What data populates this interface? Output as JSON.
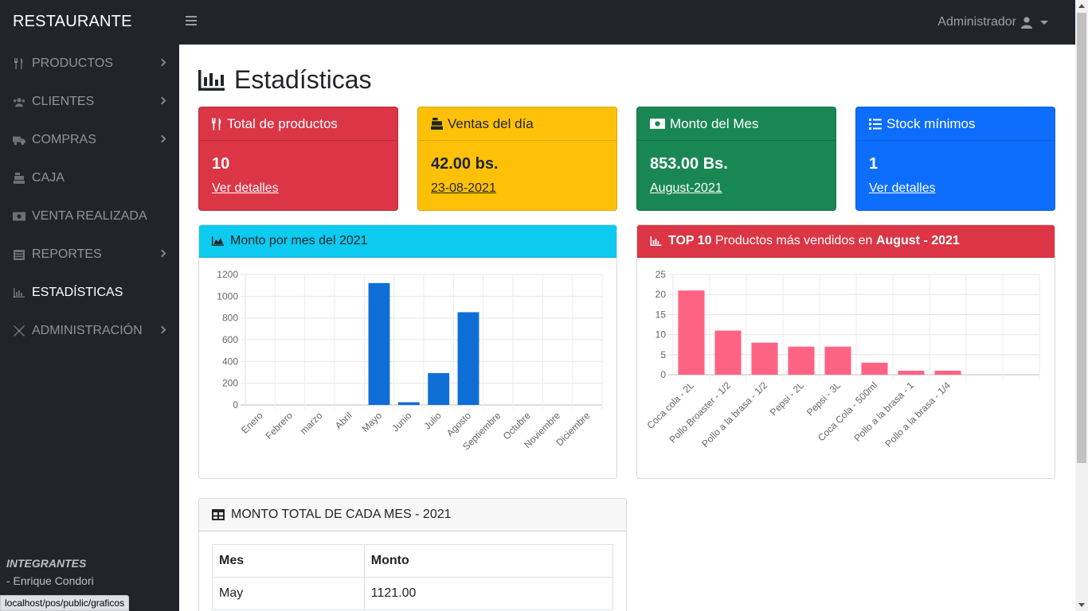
{
  "app": {
    "brand": "RESTAURANTE",
    "user": "Administrador"
  },
  "sidebar": {
    "items": [
      {
        "label": "PRODUCTOS",
        "icon": "utensils-icon",
        "has_submenu": true
      },
      {
        "label": "CLIENTES",
        "icon": "users-icon",
        "has_submenu": true
      },
      {
        "label": "COMPRAS",
        "icon": "truck-icon",
        "has_submenu": true
      },
      {
        "label": "CAJA",
        "icon": "cash-register-icon",
        "has_submenu": false
      },
      {
        "label": "VENTA REALIZADA",
        "icon": "money-bill-icon",
        "has_submenu": false
      },
      {
        "label": "REPORTES",
        "icon": "list-icon",
        "has_submenu": true
      },
      {
        "label": "ESTADÍSTICAS",
        "icon": "chart-bar-icon",
        "has_submenu": false,
        "active": true
      },
      {
        "label": "ADMINISTRACIÓN",
        "icon": "tools-icon",
        "has_submenu": true
      }
    ],
    "footer": {
      "heading": "INTEGRANTES",
      "members": [
        "- Enrique Condori"
      ]
    }
  },
  "status_url": "localhost/pos/public/graficos",
  "page": {
    "title": "Estadísticas"
  },
  "cards": [
    {
      "title": "Total de productos",
      "value": "10",
      "link": "Ver detalles",
      "color": "#dc3545",
      "icon": "utensils-icon"
    },
    {
      "title": "Ventas del día",
      "value": "42.00 bs.",
      "link": "23-08-2021",
      "color": "#ffc107",
      "icon": "cash-register-icon"
    },
    {
      "title": "Monto del Mes",
      "value": "853.00 Bs.",
      "link": "August-2021",
      "color": "#198754",
      "icon": "money-bill-icon"
    },
    {
      "title": "Stock mínimos",
      "value": "1",
      "link": "Ver detalles",
      "color": "#0d6efd",
      "icon": "list-icon"
    }
  ],
  "panel_monthly": {
    "title": "Monto por mes del 2021"
  },
  "panel_top": {
    "title_bold_1": "TOP 10",
    "title_middle": " Productos más vendidos en ",
    "title_bold_2": "August - 2021"
  },
  "panel_table": {
    "title": "MONTO TOTAL DE CADA MES - 2021",
    "headers": [
      "Mes",
      "Monto"
    ],
    "rows": [
      [
        "May",
        "1121.00"
      ]
    ]
  },
  "chart_data": [
    {
      "type": "bar",
      "categories": [
        "Enero",
        "Febrero",
        "marzo",
        "Abril",
        "Mayo",
        "Junio",
        "Julio",
        "Agosto",
        "Septiembre",
        "Octubre",
        "Noviembre",
        "Diciembre"
      ],
      "values": [
        0,
        0,
        0,
        0,
        1121,
        25,
        293,
        853,
        0,
        0,
        0,
        0
      ],
      "ylim": [
        0,
        1200
      ],
      "yticks": [
        0,
        200,
        400,
        600,
        800,
        1000,
        1200
      ],
      "color": "#0d6fd6"
    },
    {
      "type": "bar",
      "categories": [
        "Coca cola - 2L",
        "Pollo Broaster - 1/2",
        "Pollo a la brasa - 1/2",
        "Pepsi - 2L",
        "Pepsi - 3L",
        "Coca Cola - 500ml",
        "Pollo a la brasa - 1",
        "Pollo a la brasa - 1/4",
        "",
        ""
      ],
      "values": [
        21,
        11,
        8,
        7,
        7,
        3,
        1,
        1,
        0,
        0
      ],
      "ylim": [
        0,
        25
      ],
      "yticks": [
        0,
        5,
        10,
        15,
        20,
        25
      ],
      "color": "#ff6384"
    }
  ]
}
